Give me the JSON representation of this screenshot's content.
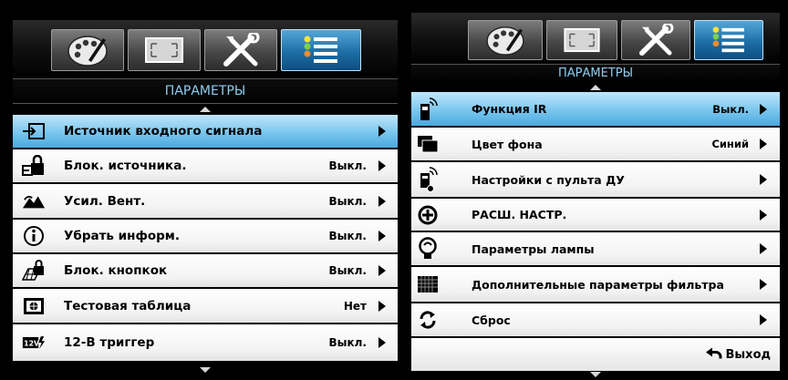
{
  "colors": {
    "header_text": "#8fcdf0",
    "selected_row": "#7ac6ee",
    "active_tab": "#1d6ea7",
    "row_background": "#f3f3f3"
  },
  "left_panel": {
    "tabs": [
      {
        "icon": "palette-icon"
      },
      {
        "icon": "display-frame-icon"
      },
      {
        "icon": "tools-icon"
      },
      {
        "icon": "options-list-icon",
        "active": true
      }
    ],
    "title": "ПАРАМЕТРЫ",
    "items": [
      {
        "icon": "input-source-icon",
        "label": "Источник входного сигнала",
        "value": "",
        "selected": true
      },
      {
        "icon": "source-lock-icon",
        "label": "Блок. источника.",
        "value": "Выкл."
      },
      {
        "icon": "fan-boost-icon",
        "label": "Усил. Вент.",
        "value": "Выкл."
      },
      {
        "icon": "info-hide-icon",
        "label": "Убрать информ.",
        "value": "Выкл."
      },
      {
        "icon": "keypad-lock-icon",
        "label": "Блок. кнопкок",
        "value": "Выкл."
      },
      {
        "icon": "test-pattern-icon",
        "label": "Тестовая таблица",
        "value": "Нет"
      },
      {
        "icon": "12v-trigger-icon",
        "label": "12-В триггер",
        "value": "Выкл."
      }
    ]
  },
  "right_panel": {
    "tabs": [
      {
        "icon": "palette-icon"
      },
      {
        "icon": "display-frame-icon"
      },
      {
        "icon": "tools-icon"
      },
      {
        "icon": "options-list-icon",
        "active": true
      }
    ],
    "title": "ПАРАМЕТРЫ",
    "items": [
      {
        "icon": "ir-function-icon",
        "label": "Функция IR",
        "value": "Выкл.",
        "selected": true
      },
      {
        "icon": "background-color-icon",
        "label": "Цвет фона",
        "value": "Синий"
      },
      {
        "icon": "remote-settings-icon",
        "label": "Настройки с пульта ДУ",
        "value": ""
      },
      {
        "icon": "advanced-settings-icon",
        "label": "РАСШ. НАСТР.",
        "value": ""
      },
      {
        "icon": "lamp-settings-icon",
        "label": "Параметры лампы",
        "value": ""
      },
      {
        "icon": "filter-settings-icon",
        "label": "Дополнительные параметры фильтра",
        "value": ""
      },
      {
        "icon": "reset-icon",
        "label": "Сброс",
        "value": ""
      }
    ],
    "exit_label": "Выход"
  }
}
